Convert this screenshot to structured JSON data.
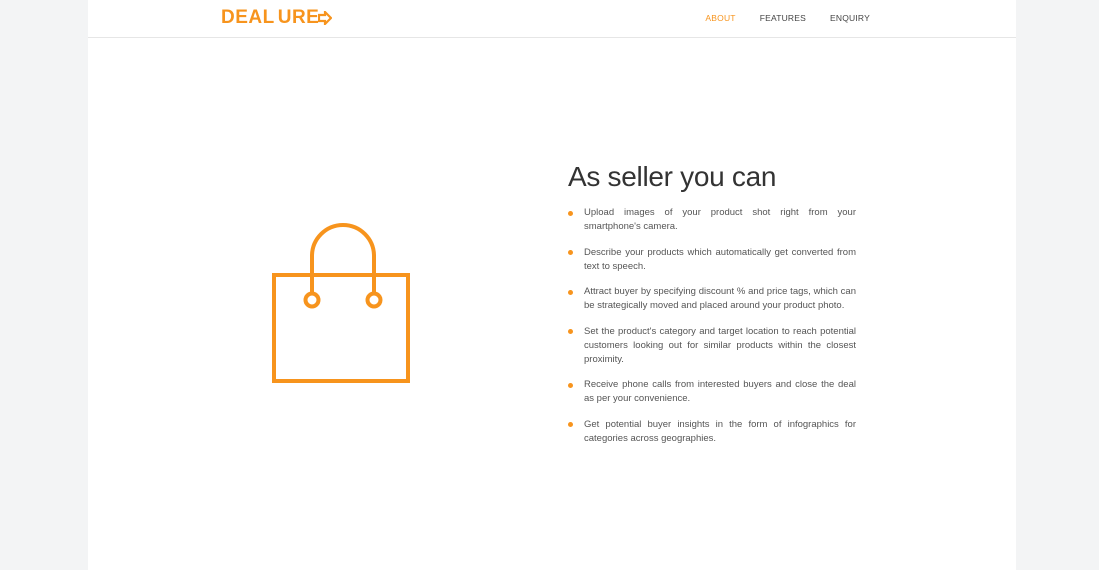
{
  "brand": {
    "logo_part1": "DEAL",
    "logo_part2": "URE",
    "accent_color": "#f7941d",
    "logo_icon": "arrow-right-icon"
  },
  "nav": {
    "items": [
      {
        "label": "ABOUT",
        "active": true
      },
      {
        "label": "FEATURES",
        "active": false
      },
      {
        "label": "ENQUIRY",
        "active": false
      }
    ]
  },
  "illustration": {
    "icon": "shopping-bag-icon"
  },
  "section": {
    "title": "As seller you can",
    "features": [
      "Upload images of your product shot right from your smartphone's camera.",
      "Describe your products which automatically get converted from text to speech.",
      "Attract buyer by specifying discount % and price tags, which can be strategically moved and placed around your product photo.",
      "Set the product's category and target location to reach potential customers looking out for similar products within the closest proximity.",
      "Receive phone calls from interested buyers and close the deal as per your convenience.",
      "Get potential buyer insights in the form of infographics for categories across geographies."
    ]
  }
}
